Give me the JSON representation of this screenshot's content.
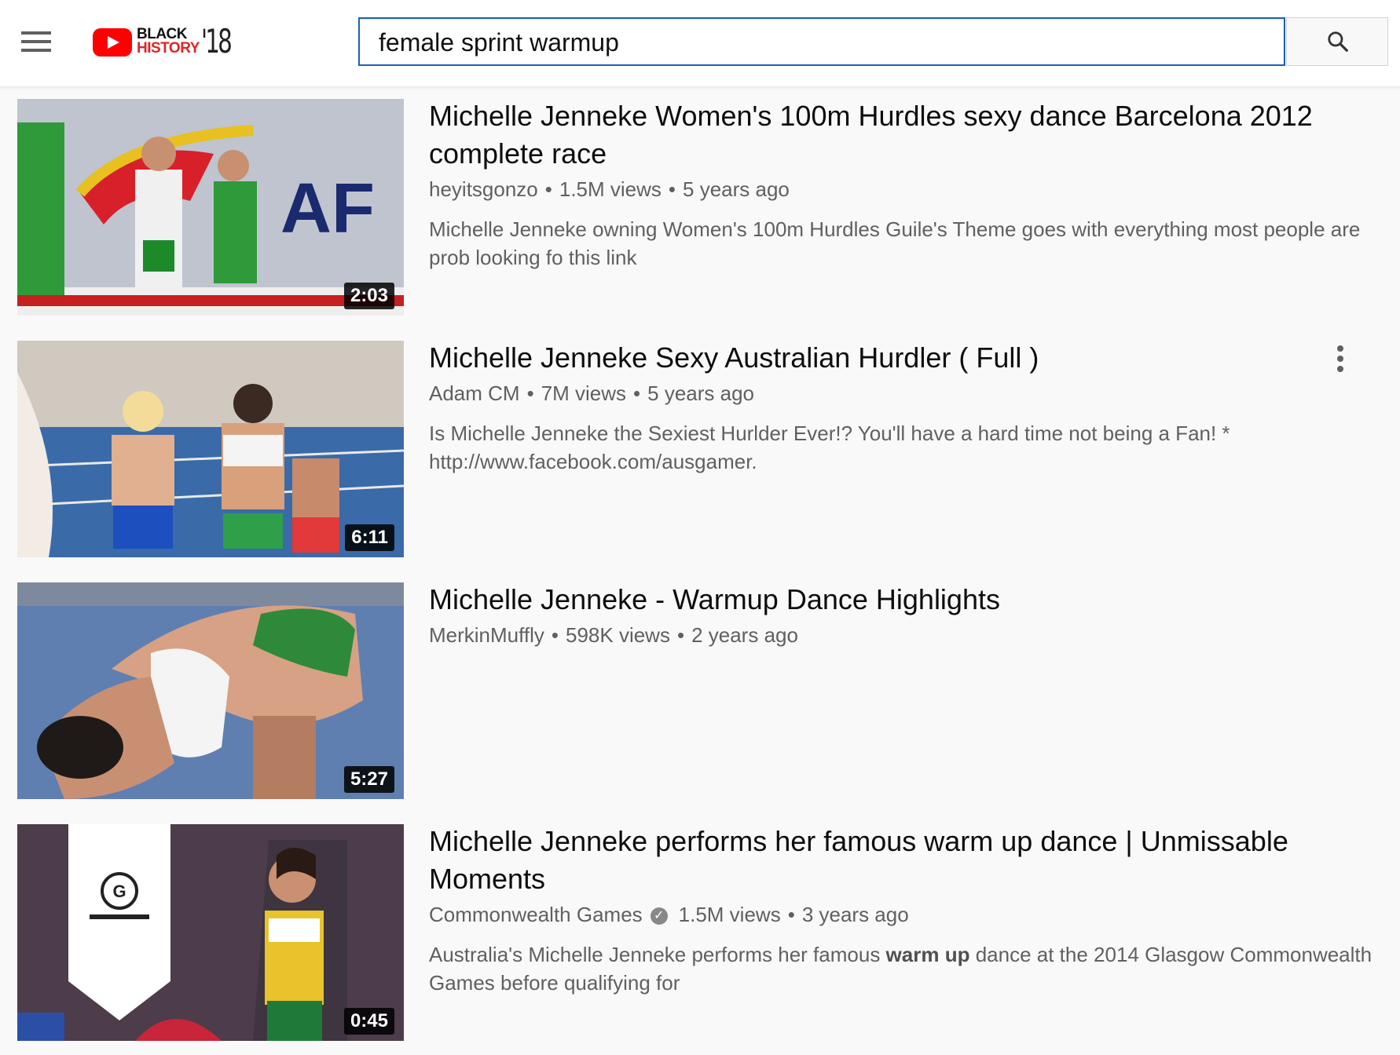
{
  "header": {
    "menu_icon": "hamburger-menu-icon",
    "logo": {
      "line1": "BLACK",
      "line2": "HISTORY",
      "year": "'18"
    },
    "search": {
      "value": "female sprint warmup",
      "placeholder": "Search"
    },
    "search_icon": "search-icon"
  },
  "results": [
    {
      "title": "Michelle Jenneke Women's 100m Hurdles sexy dance Barcelona 2012 complete race",
      "channel": "heyitsgonzo",
      "views": "1.5M views",
      "age": "5 years ago",
      "description": "Michelle Jenneke owning Women's 100m Hurdles Guile's Theme goes with everything most people are prob looking fo this link",
      "duration": "2:03"
    },
    {
      "title": "Michelle Jenneke Sexy Australian Hurdler ( Full )",
      "channel": "Adam CM",
      "views": "7M views",
      "age": "5 years ago",
      "description": "Is Michelle Jenneke the Sexiest Hurlder Ever!? You'll have a hard time not being a Fan! * http://www.facebook.com/ausgamer.",
      "duration": "6:11",
      "more_icon": "more-vert-icon"
    },
    {
      "title": "Michelle Jenneke - Warmup Dance Highlights",
      "channel": "MerkinMuffly",
      "views": "598K views",
      "age": "2 years ago",
      "description": "",
      "duration": "5:27"
    },
    {
      "title": "Michelle Jenneke performs her famous warm up dance | Unmissable Moments",
      "channel": "Commonwealth Games",
      "verified_icon": "verified-check-icon",
      "views": "1.5M views",
      "age": "3 years ago",
      "description_pre": "Australia's Michelle Jenneke performs her famous ",
      "description_bold": "warm up",
      "description_post": " dance at the 2014 Glasgow Commonwealth Games before qualifying for",
      "duration": "0:45"
    }
  ],
  "colors": {
    "accent": "#1c62b9",
    "youtube_red": "#ff0000",
    "background": "#f9f9f9",
    "meta_text": "#606060"
  }
}
